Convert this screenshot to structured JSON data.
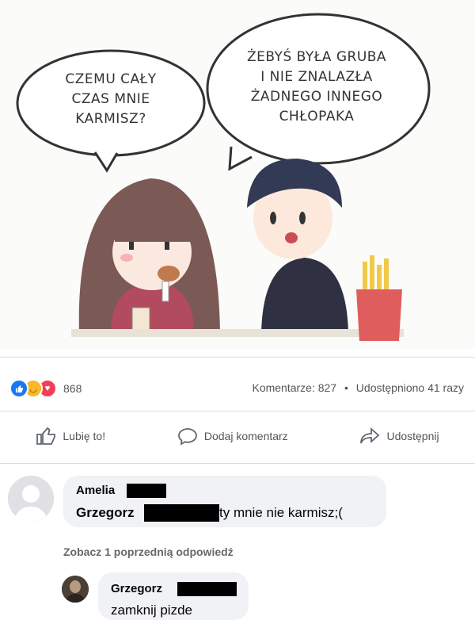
{
  "comic": {
    "left_bubble": "CZEMU CAŁY\nCZAS MNIE\nKARMISZ?",
    "right_bubble": "ŻEBYŚ BYŁA GRUBA\nI NIE ZNALAZŁA\nŻADNEGO INNEGO\nCHŁOPAKA"
  },
  "stats": {
    "reaction_count": "868",
    "comments_label": "Komentarze: 827",
    "separator": "•",
    "shares_label": "Udostępniono 41 razy"
  },
  "actions": {
    "like_label": "Lubię to!",
    "comment_label": "Dodaj komentarz",
    "share_label": "Udostępnij"
  },
  "comments": [
    {
      "author": "Amelia",
      "mention": "Grzegorz",
      "text": "ty mnie nie karmisz;("
    }
  ],
  "view_more": "Zobacz 1 poprzednią odpowiedź",
  "reply": {
    "author": "Grzegorz",
    "text": "zamknij pizde"
  }
}
